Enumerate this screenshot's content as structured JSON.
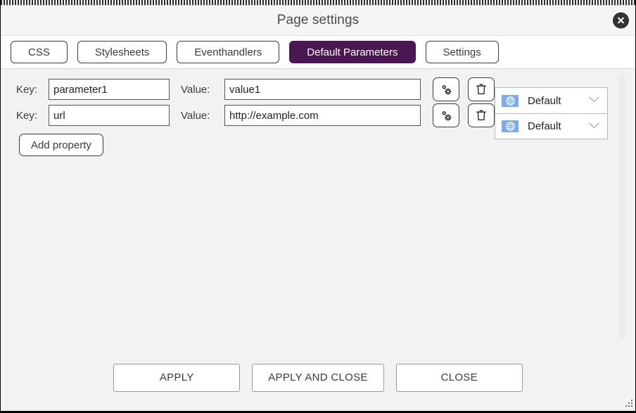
{
  "window": {
    "title": "Page settings",
    "close_icon": "close-circle-icon",
    "resize_grip_icon": "resize-grip-icon",
    "accent_color": "#4a1752",
    "background_color": "#f2f2f2"
  },
  "tabs": [
    {
      "label": "CSS",
      "active": false
    },
    {
      "label": "Stylesheets",
      "active": false
    },
    {
      "label": "Eventhandlers",
      "active": false
    },
    {
      "label": "Default Parameters",
      "active": true
    },
    {
      "label": "Settings",
      "active": false
    }
  ],
  "form": {
    "key_label": "Key:",
    "value_label": "Value:",
    "key_placeholder": "",
    "value_placeholder": "",
    "settings_icon": "cogs-icon",
    "delete_icon": "trash-icon",
    "rows": [
      {
        "key": "parameter1",
        "value": "value1"
      },
      {
        "key": "url",
        "value": "http://example.com"
      }
    ],
    "add_button_label": "Add property"
  },
  "language_dropdowns": [
    {
      "label": "Default",
      "flag_icon": "globe-flag-icon",
      "caret_icon": "chevron-down-icon"
    },
    {
      "label": "Default",
      "flag_icon": "globe-flag-icon",
      "caret_icon": "chevron-down-icon"
    }
  ],
  "footer": {
    "apply_label": "APPLY",
    "apply_and_close_label": "APPLY AND CLOSE",
    "close_label": "CLOSE"
  },
  "scrollbar": {
    "orientation": "vertical"
  }
}
